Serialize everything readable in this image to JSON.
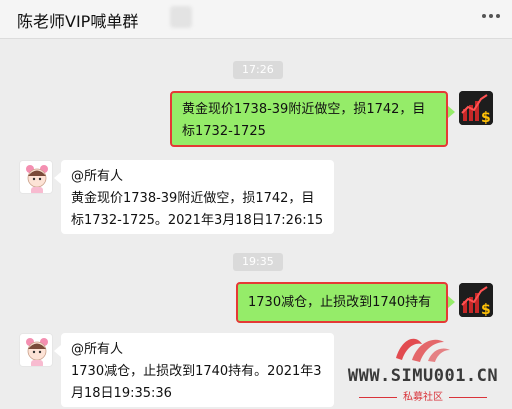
{
  "header": {
    "title": "陈老师VIP喊单群",
    "more_icon": "more-dots-icon"
  },
  "messages": [
    {
      "type": "time",
      "text": "17:26"
    },
    {
      "type": "sent",
      "lines": [
        "黄金现价1738-39附近做空，损1742，目",
        "标1732-1725"
      ]
    },
    {
      "type": "received",
      "lines": [
        "@所有人",
        "黄金现价1738-39附近做空，损1742，目",
        "标1732-1725。2021年3月18日17:26:15"
      ]
    },
    {
      "type": "time",
      "text": "19:35"
    },
    {
      "type": "sent",
      "lines": [
        "1730减仓，止损改到1740持有"
      ]
    },
    {
      "type": "received",
      "lines": [
        "@所有人",
        "1730减仓，止损改到1740持有。2021年3",
        "月18日19:35:36"
      ]
    }
  ],
  "watermark": {
    "site": "WWW.SIMU001.CN",
    "sub": "私募社区"
  },
  "colors": {
    "sent_bubble": "#95ec69",
    "highlight_border": "#e53935",
    "background": "#ededed"
  }
}
